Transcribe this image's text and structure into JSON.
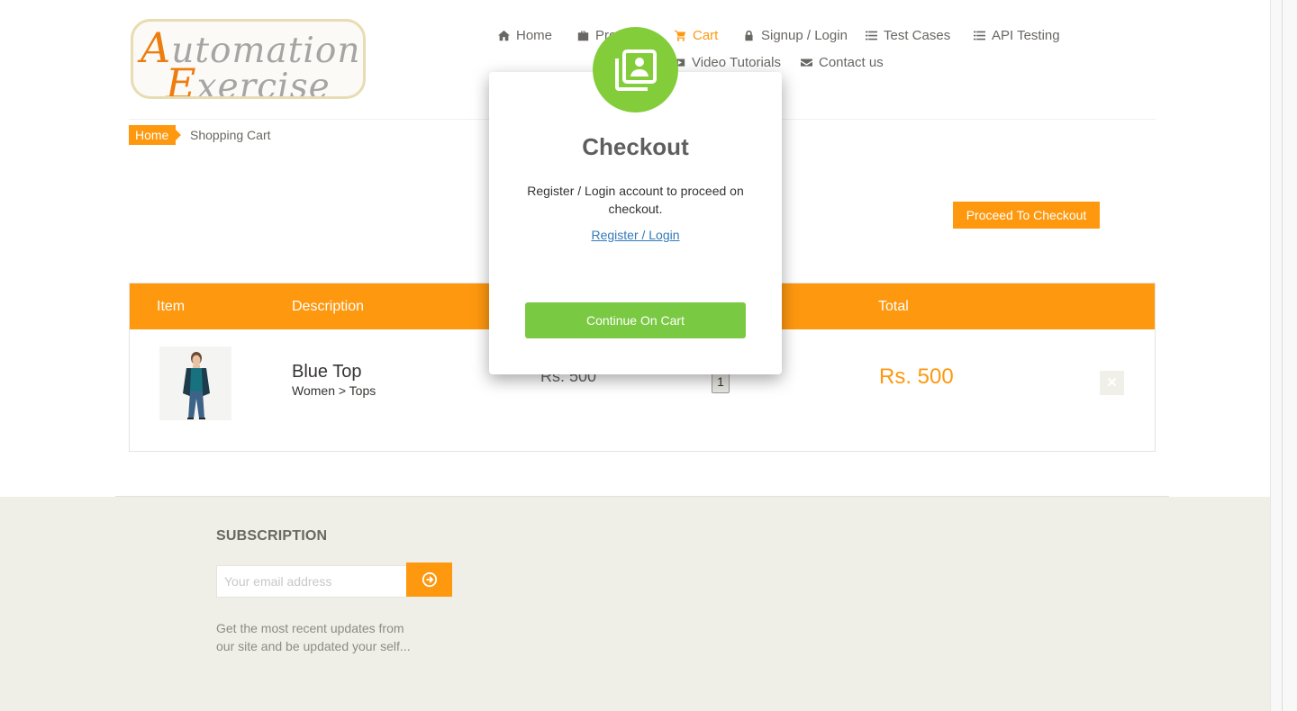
{
  "logo": {
    "line1_cap": "A",
    "line1_rest": "utomation",
    "line2_cap": "E",
    "line2_rest": "xercise"
  },
  "nav": {
    "home": "Home",
    "products": "Products",
    "cart": "Cart",
    "signup": "Signup / Login",
    "test_cases": "Test Cases",
    "api_testing": "API Testing",
    "video_tutorials": "Video Tutorials",
    "contact": "Contact us"
  },
  "breadcrumb": {
    "home": "Home",
    "current": "Shopping Cart"
  },
  "proceed_label": "Proceed To Checkout",
  "cart": {
    "headers": {
      "item": "Item",
      "description": "Description",
      "total": "Total"
    },
    "items": [
      {
        "name": "Blue Top",
        "category": "Women > Tops",
        "price": "Rs. 500",
        "quantity": "1",
        "total": "Rs. 500"
      }
    ]
  },
  "footer": {
    "subscription_title": "SUBSCRIPTION",
    "email_placeholder": "Your email address",
    "subscription_text": "Get the most recent updates from our site and be updated your self..."
  },
  "modal": {
    "title": "Checkout",
    "message": "Register / Login account to proceed on checkout.",
    "link": "Register / Login",
    "button": "Continue On Cart"
  },
  "colors": {
    "accent": "#fe980f",
    "success": "#7ac943",
    "link": "#337ab7"
  }
}
